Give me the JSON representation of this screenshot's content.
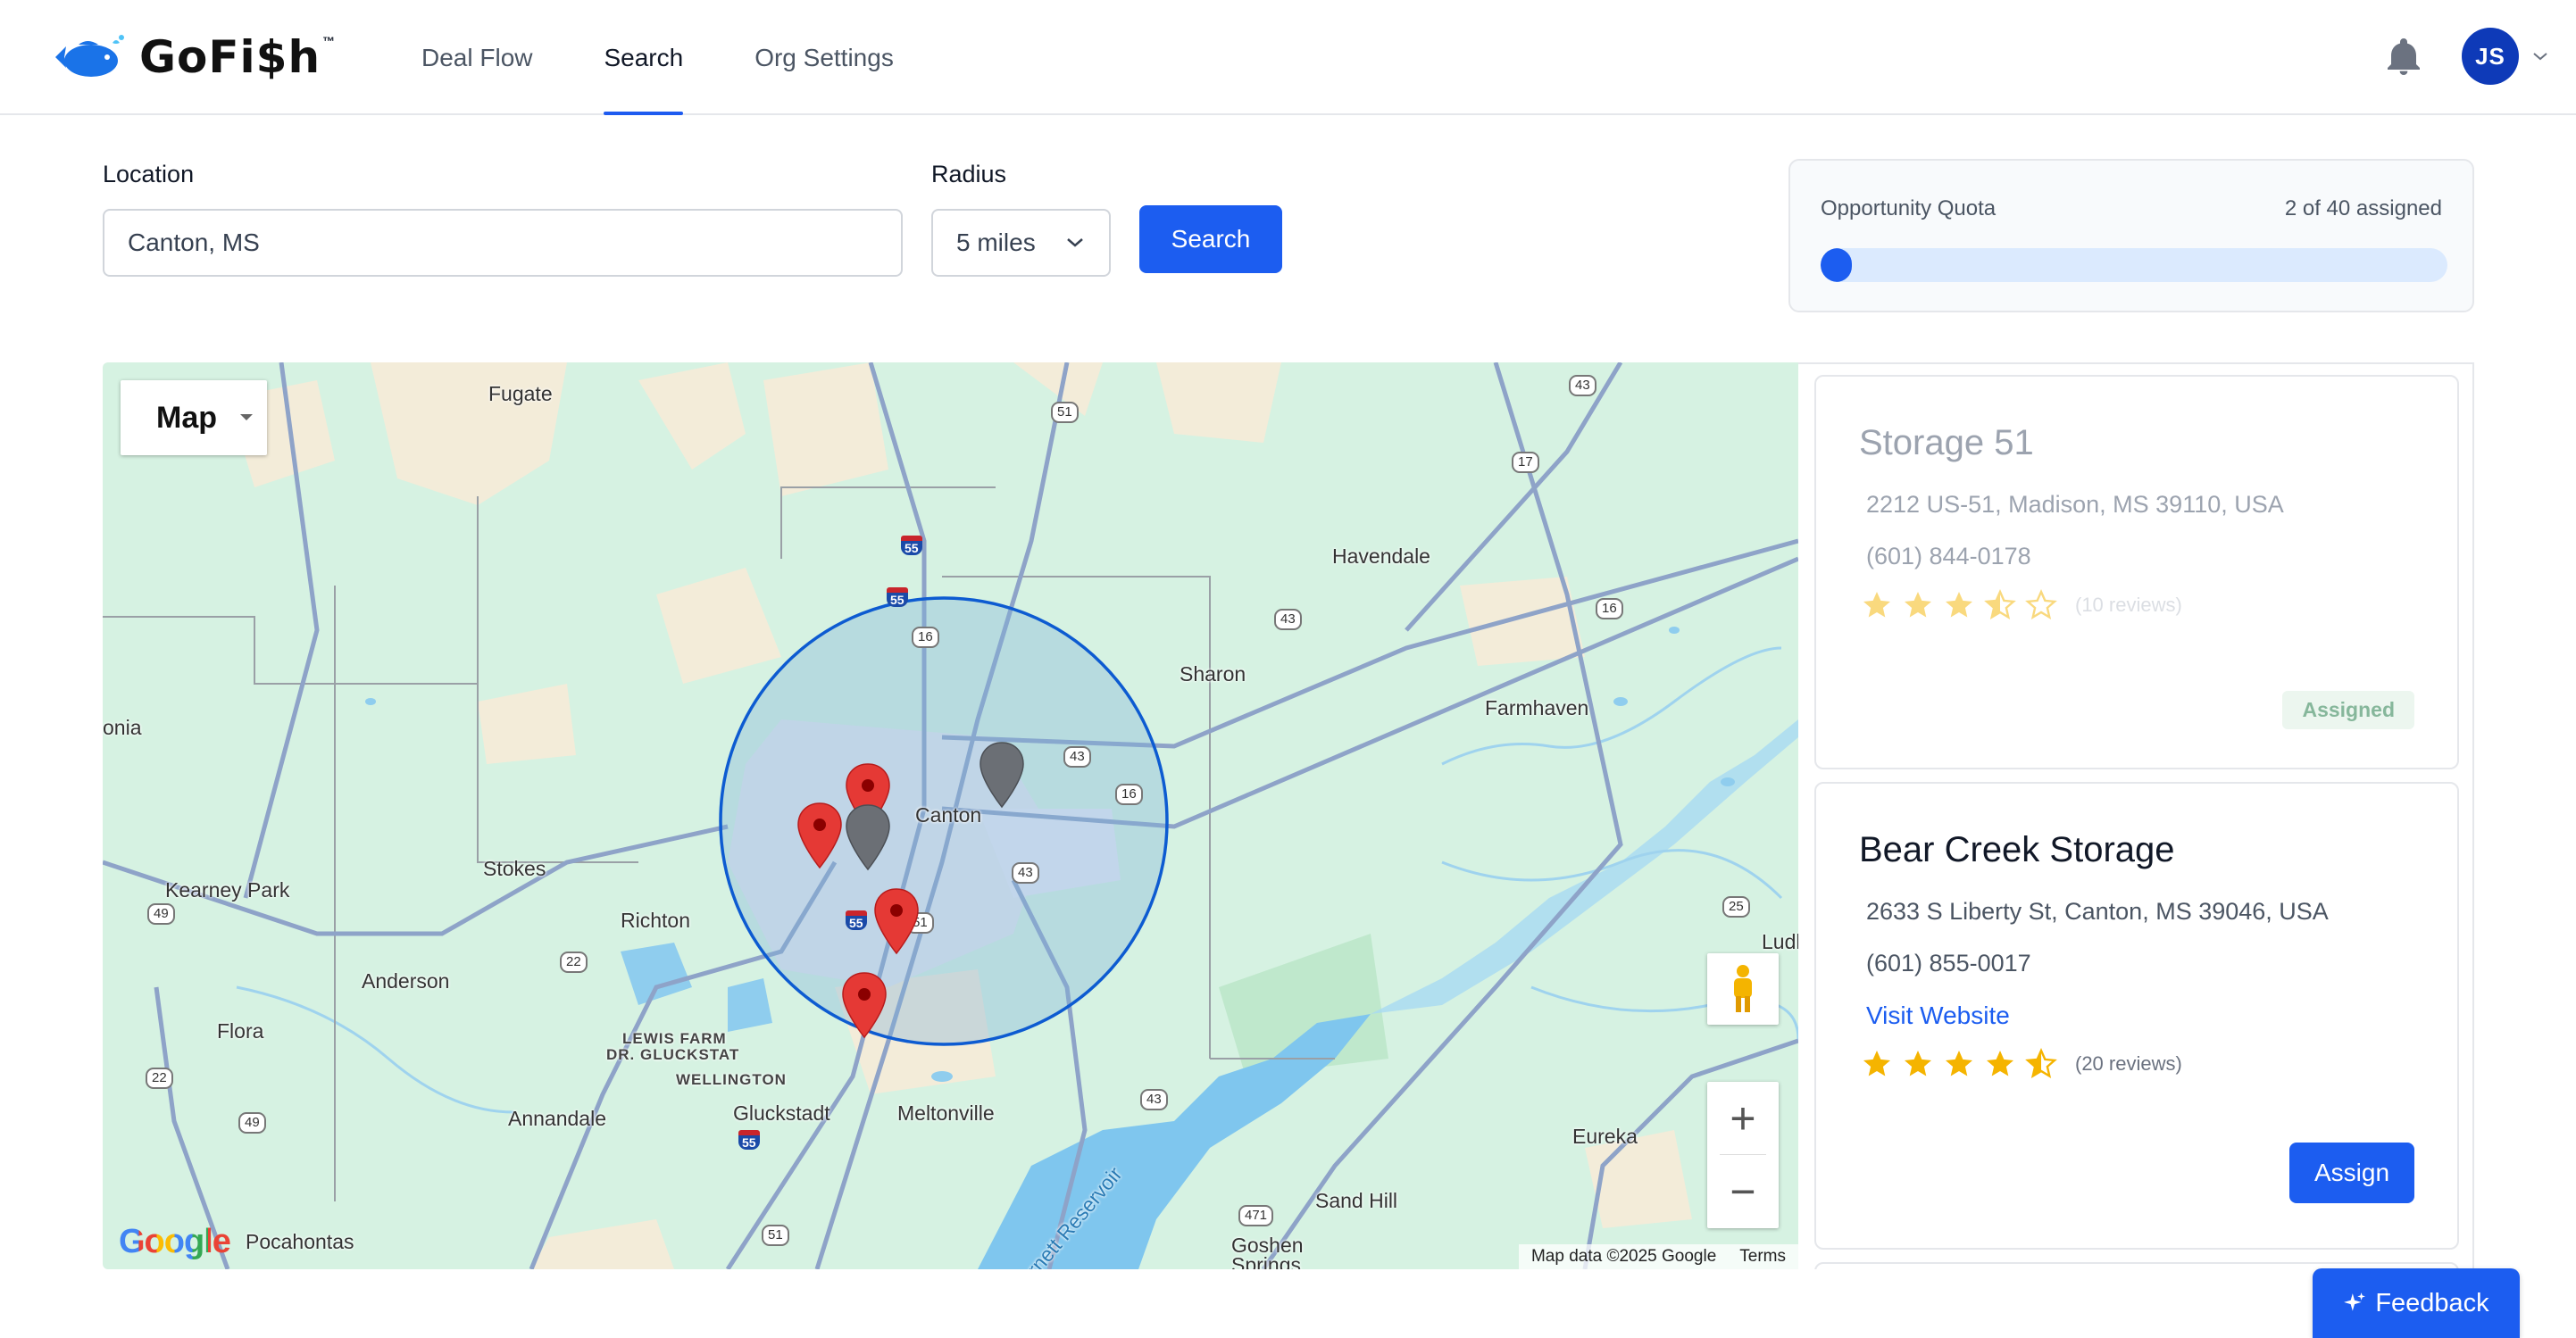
{
  "brand": {
    "name": "GoFi$h",
    "tm": "™"
  },
  "nav": {
    "deal_flow": "Deal Flow",
    "search": "Search",
    "org_settings": "Org Settings"
  },
  "user": {
    "initials": "JS"
  },
  "search": {
    "location_label": "Location",
    "location_value": "Canton, MS",
    "radius_label": "Radius",
    "radius_value": "5 miles",
    "button": "Search"
  },
  "quota": {
    "title": "Opportunity Quota",
    "count_text": "2 of 40 assigned",
    "assigned": 2,
    "total": 40
  },
  "map": {
    "type_control": "Map",
    "attribution": "Map data ©2025 Google",
    "terms": "Terms",
    "google": "Google",
    "places": {
      "fugate": "Fugate",
      "havendale": "Havendale",
      "sharon": "Sharon",
      "farmhaven": "Farmhaven",
      "canton": "Canton",
      "stokes": "Stokes",
      "kearney_park": "Kearney Park",
      "richton": "Richton",
      "anderson": "Anderson",
      "flora": "Flora",
      "lewis_farm": "LEWIS FARM",
      "dr_gluckstat": "DR. GLUCKSTAT",
      "wellington": "WELLINGTON",
      "annandale": "Annandale",
      "gluckstadt": "Gluckstadt",
      "meltonville": "Meltonville",
      "eureka": "Eureka",
      "sand_hill": "Sand Hill",
      "gosher": "Goshen",
      "springs": "Springs",
      "pocahontas": "Pocahontas",
      "ludl": "Ludl",
      "onia": "onia",
      "reservoir": "Barnett Reservoir"
    },
    "shields": {
      "r43a": "43",
      "r51a": "51",
      "r17": "17",
      "r55a": "55",
      "r55b": "55",
      "r16a": "16",
      "r43b": "43",
      "r16b": "16",
      "r43c": "43",
      "r16c": "16",
      "r43d": "43",
      "r55c": "55",
      "r51b": "51",
      "r49a": "49",
      "r22a": "22",
      "r22b": "22",
      "r49b": "49",
      "r55d": "55",
      "r43e": "43",
      "r471": "471",
      "r51c": "51",
      "r25": "25"
    }
  },
  "listings": [
    {
      "name": "Storage 51",
      "address": "2212 US-51, Madison, MS 39110, USA",
      "phone": "(601) 844-0178",
      "rating": 3.5,
      "reviews": "(10 reviews)",
      "status": "Assigned"
    },
    {
      "name": "Bear Creek Storage",
      "address": "2633 S Liberty St, Canton, MS 39046, USA",
      "phone": "(601) 855-0017",
      "website": "Visit Website",
      "rating": 4.5,
      "reviews": "(20 reviews)",
      "action": "Assign"
    }
  ],
  "feedback": {
    "label": "Feedback"
  },
  "colors": {
    "primary": "#1c5df0",
    "map_green": "#d6f2e2",
    "radius_stroke": "#0d5bd1",
    "marker_red": "#e53935",
    "marker_gray": "#6b6f75",
    "star": "#f5b400"
  }
}
